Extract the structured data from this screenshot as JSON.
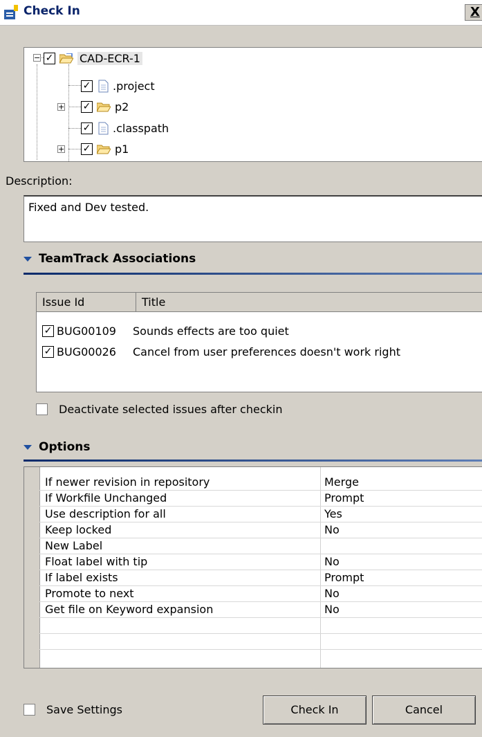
{
  "window": {
    "title": "Check In",
    "close_glyph": "X"
  },
  "tree": {
    "root": {
      "label": "CAD-ECR-1",
      "icon": "open-folder-icon"
    },
    "children": [
      {
        "label": ".project",
        "icon": "file-icon"
      },
      {
        "label": "p2",
        "icon": "folder-icon"
      },
      {
        "label": ".classpath",
        "icon": "file-icon"
      },
      {
        "label": "p1",
        "icon": "folder-icon"
      }
    ]
  },
  "description": {
    "label": "Description:",
    "value": "Fixed and Dev tested."
  },
  "teamtrack": {
    "header": "TeamTrack Associations",
    "columns": [
      "Issue Id",
      "Title"
    ],
    "issues": [
      {
        "id": "BUG00109",
        "title": "Sounds effects are too quiet",
        "checked": true
      },
      {
        "id": "BUG00026",
        "title": "Cancel from user preferences doesn't work right",
        "checked": true
      }
    ],
    "deactivate_label": "Deactivate selected issues after checkin"
  },
  "options": {
    "header": "Options",
    "rows": [
      {
        "key": "If newer revision in repository",
        "value": "Merge"
      },
      {
        "key": "If Workfile Unchanged",
        "value": "Prompt"
      },
      {
        "key": "Use description for all",
        "value": "Yes"
      },
      {
        "key": "Keep locked",
        "value": "No"
      },
      {
        "key": "New Label",
        "value": ""
      },
      {
        "key": "Float label with tip",
        "value": "No"
      },
      {
        "key": "If label exists",
        "value": "Prompt"
      },
      {
        "key": "Promote to next",
        "value": "No"
      },
      {
        "key": "Get file on Keyword expansion",
        "value": "No"
      }
    ]
  },
  "footer": {
    "save_settings_label": "Save Settings",
    "check_in_label": "Check In",
    "cancel_label": "Cancel"
  },
  "colors": {
    "accent": "#0a246a",
    "section_line": "#0a2a6a",
    "dialog_bg": "#d4d0c8"
  }
}
